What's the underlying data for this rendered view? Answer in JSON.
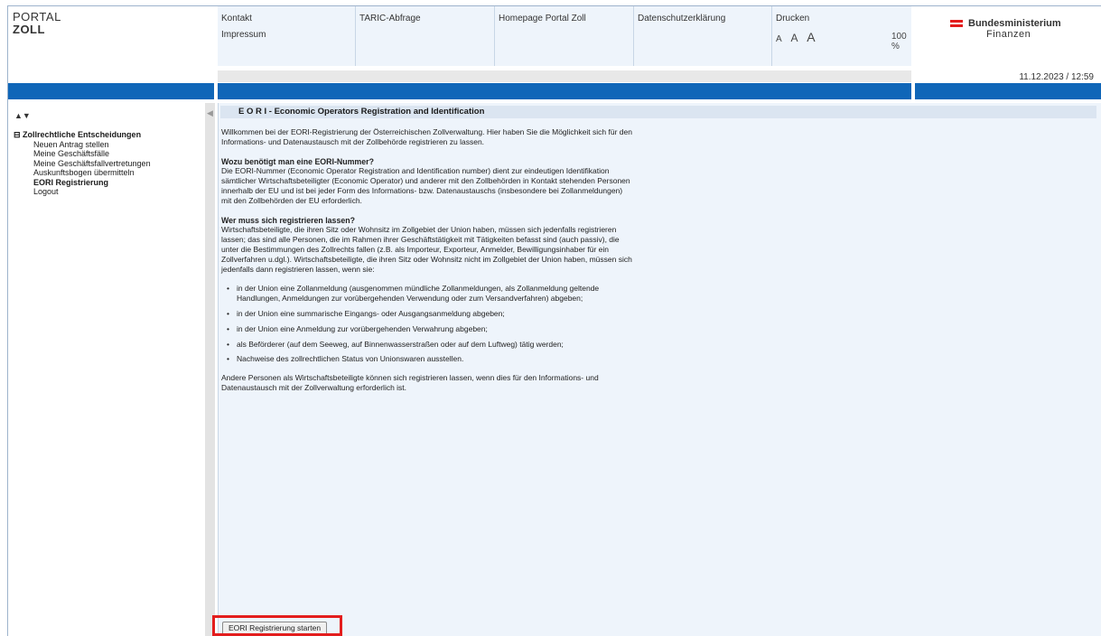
{
  "logo": {
    "line1": "PORTAL",
    "line2": "ZOLL"
  },
  "nav": {
    "kontakt": "Kontakt",
    "impressum": "Impressum",
    "taric": "TARIC-Abfrage",
    "homepage": "Homepage Portal Zoll",
    "datenschutz": "Datenschutzerklärung",
    "drucken": "Drucken",
    "fontsize_small": "A",
    "fontsize_medium": "A",
    "fontsize_large": "A",
    "zoom": "100 %"
  },
  "ministry": {
    "line1": "Bundesministerium",
    "line2": "Finanzen",
    "flag_colors": [
      "#e31d1d",
      "#ffffff",
      "#e31d1d"
    ]
  },
  "datetime": "11.12.2023 / 12:59",
  "sidebar": {
    "tools": "▲▼",
    "root": "⊟ Zollrechtliche Entscheidungen",
    "items": [
      {
        "label": "Neuen Antrag stellen"
      },
      {
        "label": "Meine Geschäftsfälle"
      },
      {
        "label": "Meine Geschäftsfallvertretungen"
      },
      {
        "label": "Auskunftsbogen übermitteln"
      },
      {
        "label": "EORI Registrierung"
      },
      {
        "label": "Logout"
      }
    ]
  },
  "content": {
    "title": "E O R I - Economic Operators Registration and Identification",
    "intro": "Willkommen bei der EORI-Registrierung der Österreichischen Zollverwaltung. Hier haben Sie die Möglichkeit sich für den Informations- und Datenaustausch mit der Zollbehörde registrieren zu lassen.",
    "h1": "Wozu benötigt man eine EORI-Nummer?",
    "p1": "Die EORI-Nummer (Economic Operator Registration and Identification number) dient zur eindeutigen Identifikation sämtlicher Wirtschaftsbeteiligter (Economic Operator) und anderer mit den Zollbehörden in Kontakt stehenden Personen innerhalb der EU und ist bei jeder Form des Informations- bzw. Datenaustauschs (insbesondere bei Zollanmeldungen) mit den Zollbehörden der EU erforderlich.",
    "h2": "Wer muss sich registrieren lassen?",
    "p2": "Wirtschaftsbeteiligte, die ihren Sitz oder Wohnsitz im Zollgebiet der Union haben, müssen sich jedenfalls registrieren lassen; das sind alle Personen, die im Rahmen ihrer Geschäftstätigkeit mit Tätigkeiten befasst sind (auch passiv), die unter die Bestimmungen des Zollrechts fallen (z.B. als Importeur, Exporteur, Anmelder, Bewilligungsinhaber für ein Zollverfahren u.dgl.). Wirtschaftsbeteiligte, die ihren Sitz oder Wohnsitz nicht im Zollgebiet der Union haben, müssen sich jedenfalls dann registrieren lassen, wenn sie:",
    "bullets": [
      "in der Union eine Zollanmeldung (ausgenommen mündliche Zollanmeldungen, als Zollanmeldung geltende Handlungen, Anmeldungen zur vorübergehenden Verwendung oder zum Versandverfahren) abgeben;",
      "in der Union eine summarische Eingangs- oder Ausgangsanmeldung abgeben;",
      "in der Union eine Anmeldung zur vorübergehenden Verwahrung abgeben;",
      "als Beförderer (auf dem Seeweg, auf Binnenwasserstraßen oder auf dem Luftweg) tätig werden;",
      "Nachweise des zollrechtlichen Status von Unionswaren ausstellen."
    ],
    "p3": "Andere Personen als Wirtschaftsbeteiligte können sich registrieren lassen, wenn dies für den Informations- und Datenaustausch mit der Zollverwaltung erforderlich ist."
  },
  "start_button": "EORI Registrierung starten",
  "splitter_arrow": "◀",
  "colors": {
    "blue_bar": "#0f66b8",
    "content_bg": "#eef4fb",
    "highlight": "#e31d1d"
  }
}
